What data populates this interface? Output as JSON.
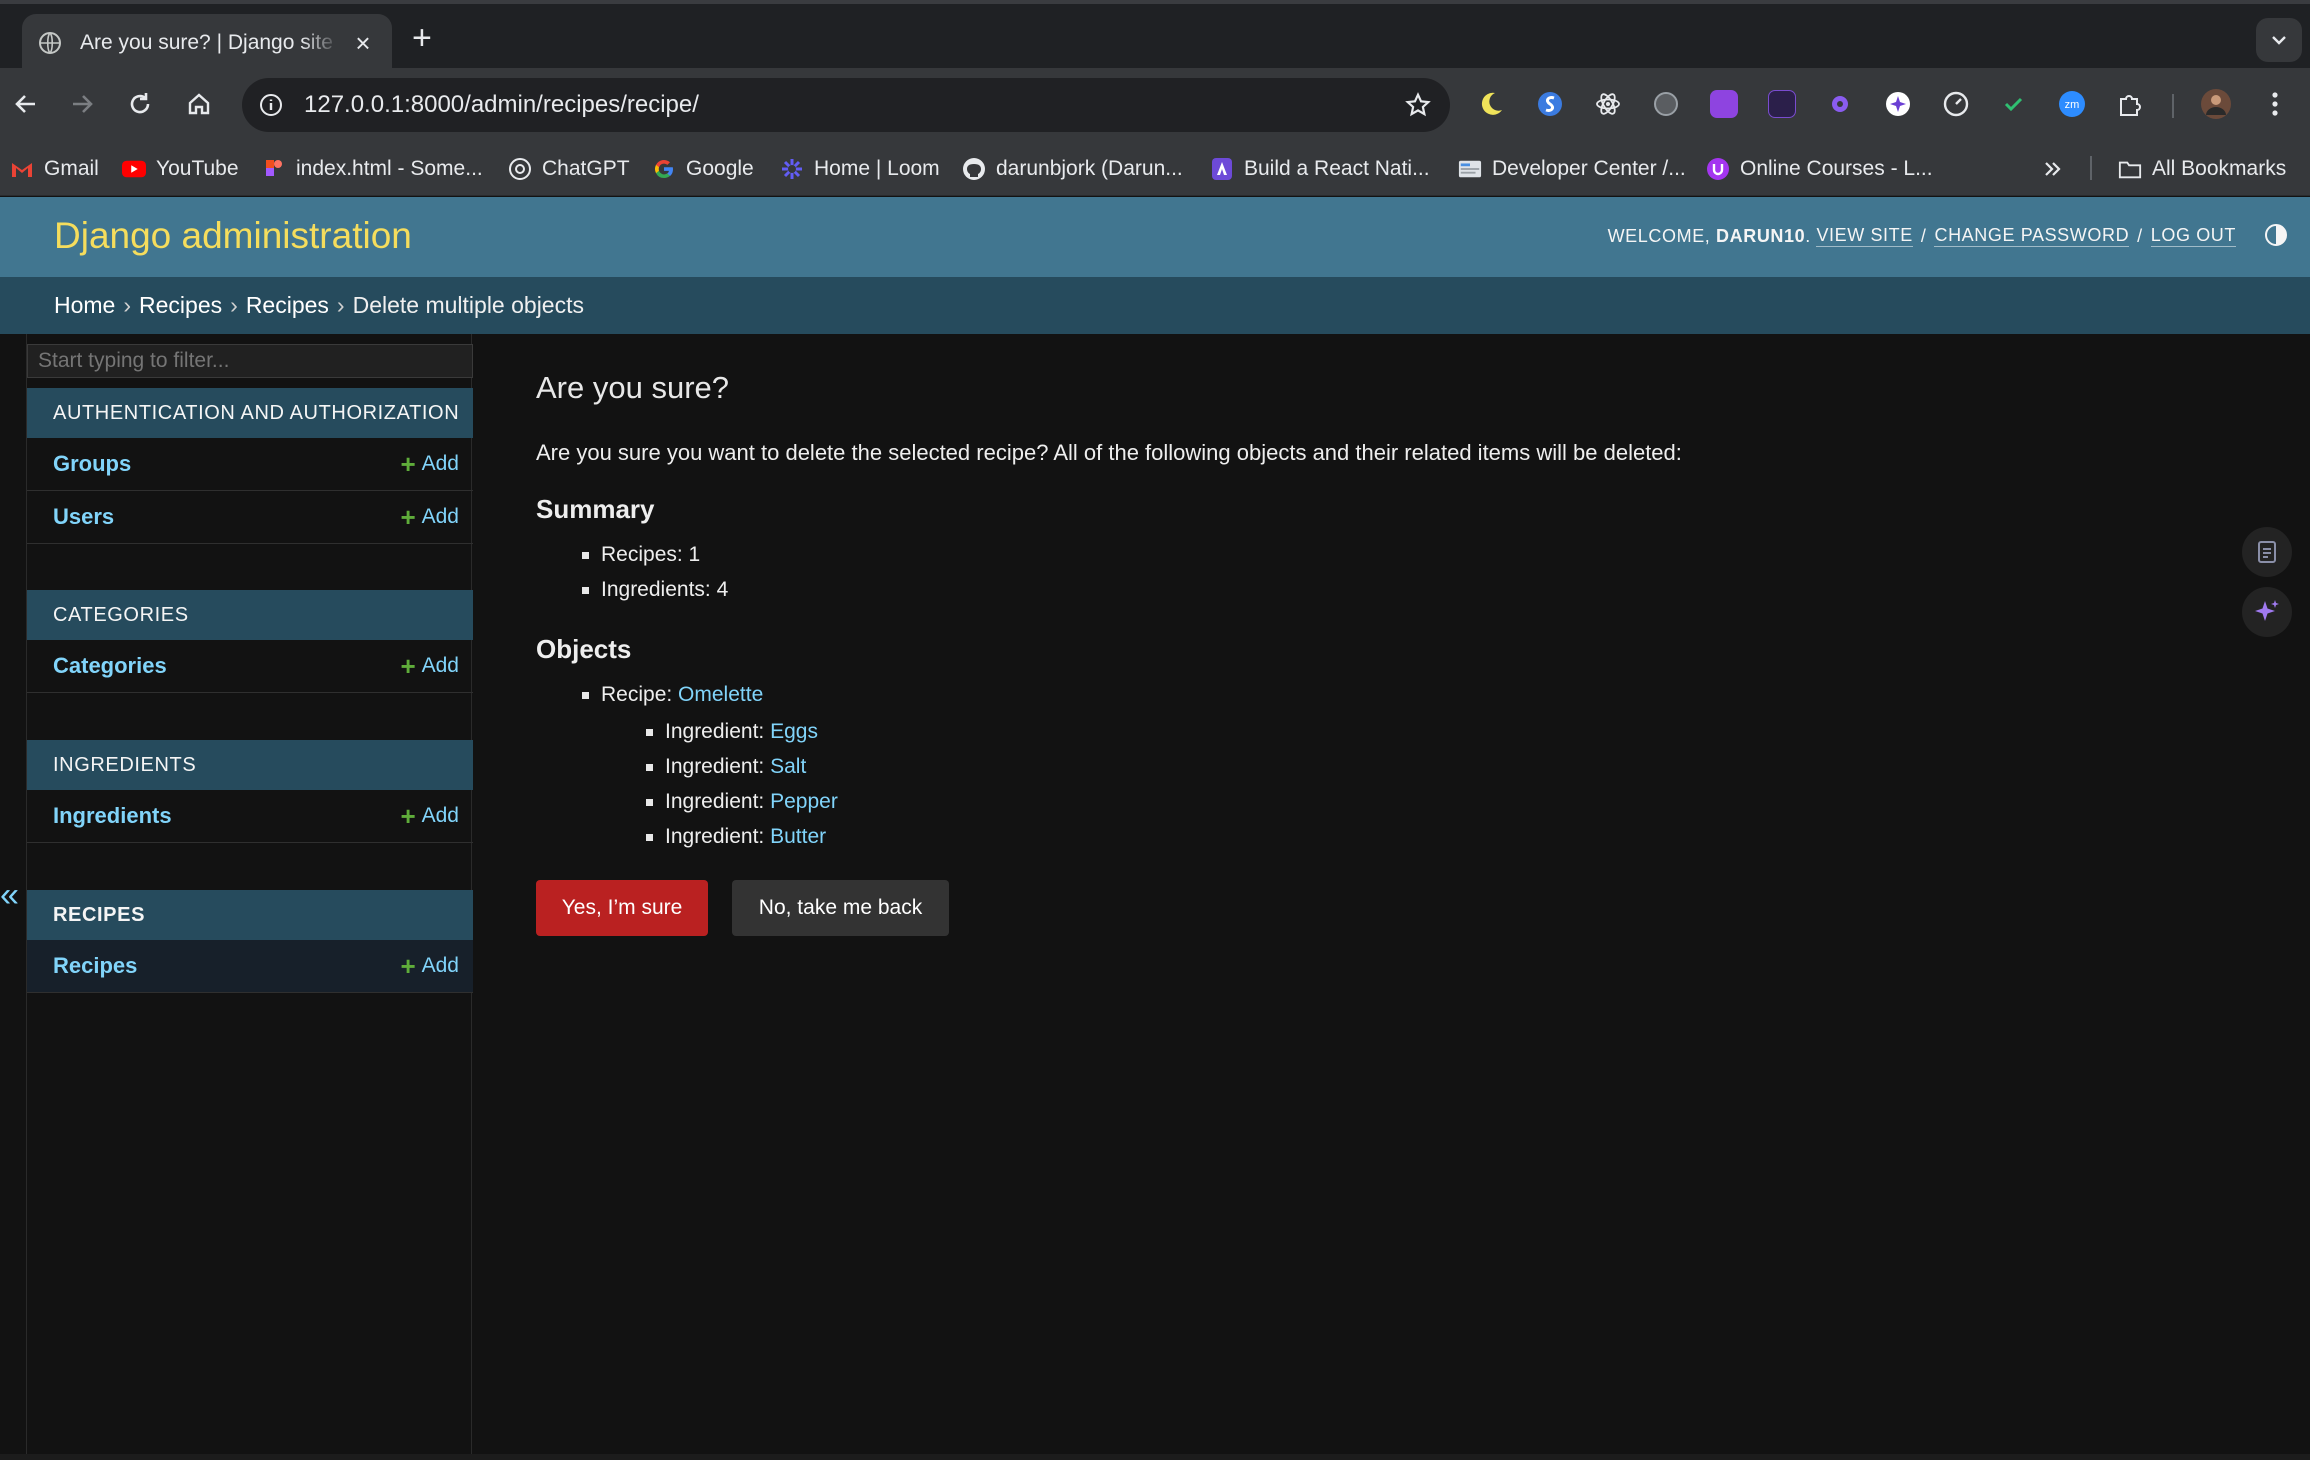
{
  "browser": {
    "tab_title": "Are you sure? | Django site admin",
    "url": "127.0.0.1:8000/admin/recipes/recipe/",
    "bookmarks": [
      {
        "label": "Gmail",
        "icon": "gmail-icon"
      },
      {
        "label": "YouTube",
        "icon": "youtube-icon"
      },
      {
        "label": "index.html - Some...",
        "icon": "figma-icon"
      },
      {
        "label": "ChatGPT",
        "icon": "chatgpt-icon"
      },
      {
        "label": "Google",
        "icon": "google-icon"
      },
      {
        "label": "Home | Loom",
        "icon": "loom-icon"
      },
      {
        "label": "darunbjork (Darun...",
        "icon": "github-icon"
      },
      {
        "label": "Build a React Nati...",
        "icon": "expo-icon"
      },
      {
        "label": "Developer Center /...",
        "icon": "developer-center-icon"
      },
      {
        "label": "Online Courses - L...",
        "icon": "udemy-icon"
      }
    ],
    "all_bookmarks_label": "All Bookmarks",
    "colors": {
      "tabstrip": "#1f2124",
      "toolbar": "#36383b",
      "omnibox": "#202124"
    }
  },
  "header": {
    "brand": "Django administration",
    "welcome": "WELCOME,",
    "username": "DARUN10",
    "period": ".",
    "view_site": "VIEW SITE",
    "change_password": "CHANGE PASSWORD",
    "log_out": "LOG OUT",
    "slash": "/"
  },
  "breadcrumbs": {
    "home": "Home",
    "app": "Recipes",
    "model": "Recipes",
    "current": "Delete multiple objects",
    "separator": "›"
  },
  "sidebar": {
    "filter_placeholder": "Start typing to filter...",
    "add_label": "Add",
    "modules": [
      {
        "caption": "AUTHENTICATION AND AUTHORIZATION",
        "models": [
          "Groups",
          "Users"
        ]
      },
      {
        "caption": "CATEGORIES",
        "models": [
          "Categories"
        ]
      },
      {
        "caption": "INGREDIENTS",
        "models": [
          "Ingredients"
        ]
      },
      {
        "caption": "RECIPES",
        "models": [
          "Recipes"
        ]
      }
    ],
    "collapse_glyph": "«"
  },
  "content": {
    "title": "Are you sure?",
    "lead": "Are you sure you want to delete the selected recipe? All of the following objects and their related items will be deleted:",
    "summary_heading": "Summary",
    "summary": [
      "Recipes: 1",
      "Ingredients: 4"
    ],
    "objects_heading": "Objects",
    "recipe_prefix": "Recipe:",
    "recipe_name": "Omelette",
    "ingredient_prefix": "Ingredient:",
    "ingredients": [
      "Eggs",
      "Salt",
      "Pepper",
      "Butter"
    ],
    "confirm_button": "Yes, I’m sure",
    "cancel_button": "No, take me back"
  },
  "theme": {
    "header_bg": "#417690",
    "brand_color": "#f5dd5d",
    "breadcrumb_bg": "#264b5d",
    "link_color": "#81d4fa",
    "danger_button": "#ba2121",
    "body_bg": "#121212"
  }
}
